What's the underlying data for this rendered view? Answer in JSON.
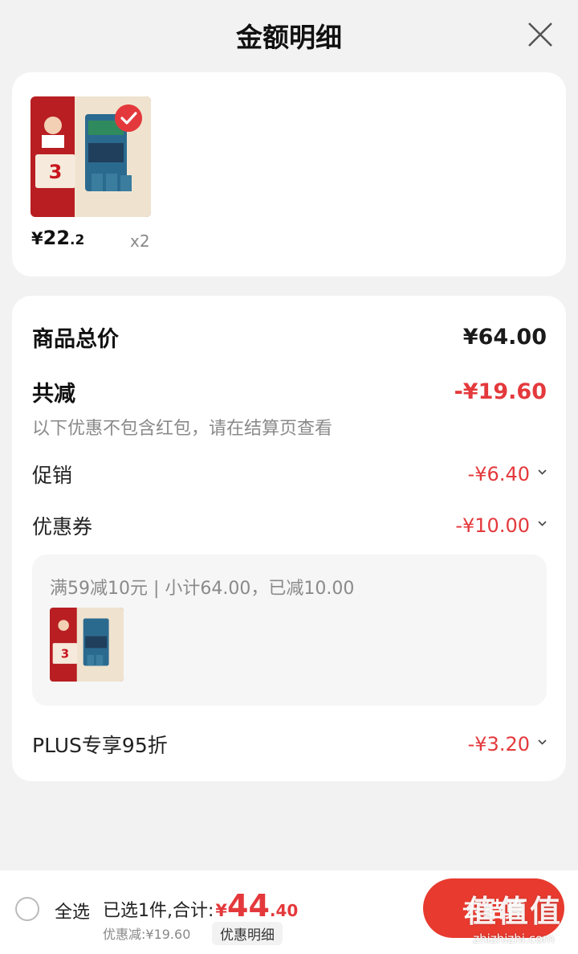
{
  "header": {
    "title": "金额明细"
  },
  "product": {
    "price_currency": "¥",
    "price_int": "22",
    "price_dec": ".2",
    "quantity": "x2",
    "selected": true
  },
  "breakdown": {
    "total_label": "商品总价",
    "total_value": "¥64.00",
    "discount_label": "共减",
    "discount_value": "-¥19.60",
    "note": "以下优惠不包含红包，请在结算页查看",
    "items": [
      {
        "label": "促销",
        "value": "-¥6.40"
      },
      {
        "label": "优惠券",
        "value": "-¥10.00"
      },
      {
        "label": "PLUS专享95折",
        "value": "-¥3.20"
      }
    ],
    "coupon_detail": "满59减10元 | 小计64.00，已减10.00"
  },
  "bottom": {
    "select_all": "全选",
    "summary_text": "已选1件,合计:",
    "total_currency": "¥",
    "total_int": "44",
    "total_dec": ".40",
    "discount_text": "优惠减:¥19.60",
    "detail_button": "优惠明细",
    "checkout_label": "去结算"
  },
  "watermark": {
    "text": "值值值",
    "sub": "zhizhizhi.com"
  },
  "colors": {
    "accent": "#e4393c",
    "background": "#f2f2f2"
  },
  "icons": [
    "close-icon",
    "check-icon",
    "chevron-down-icon",
    "radio-icon"
  ]
}
